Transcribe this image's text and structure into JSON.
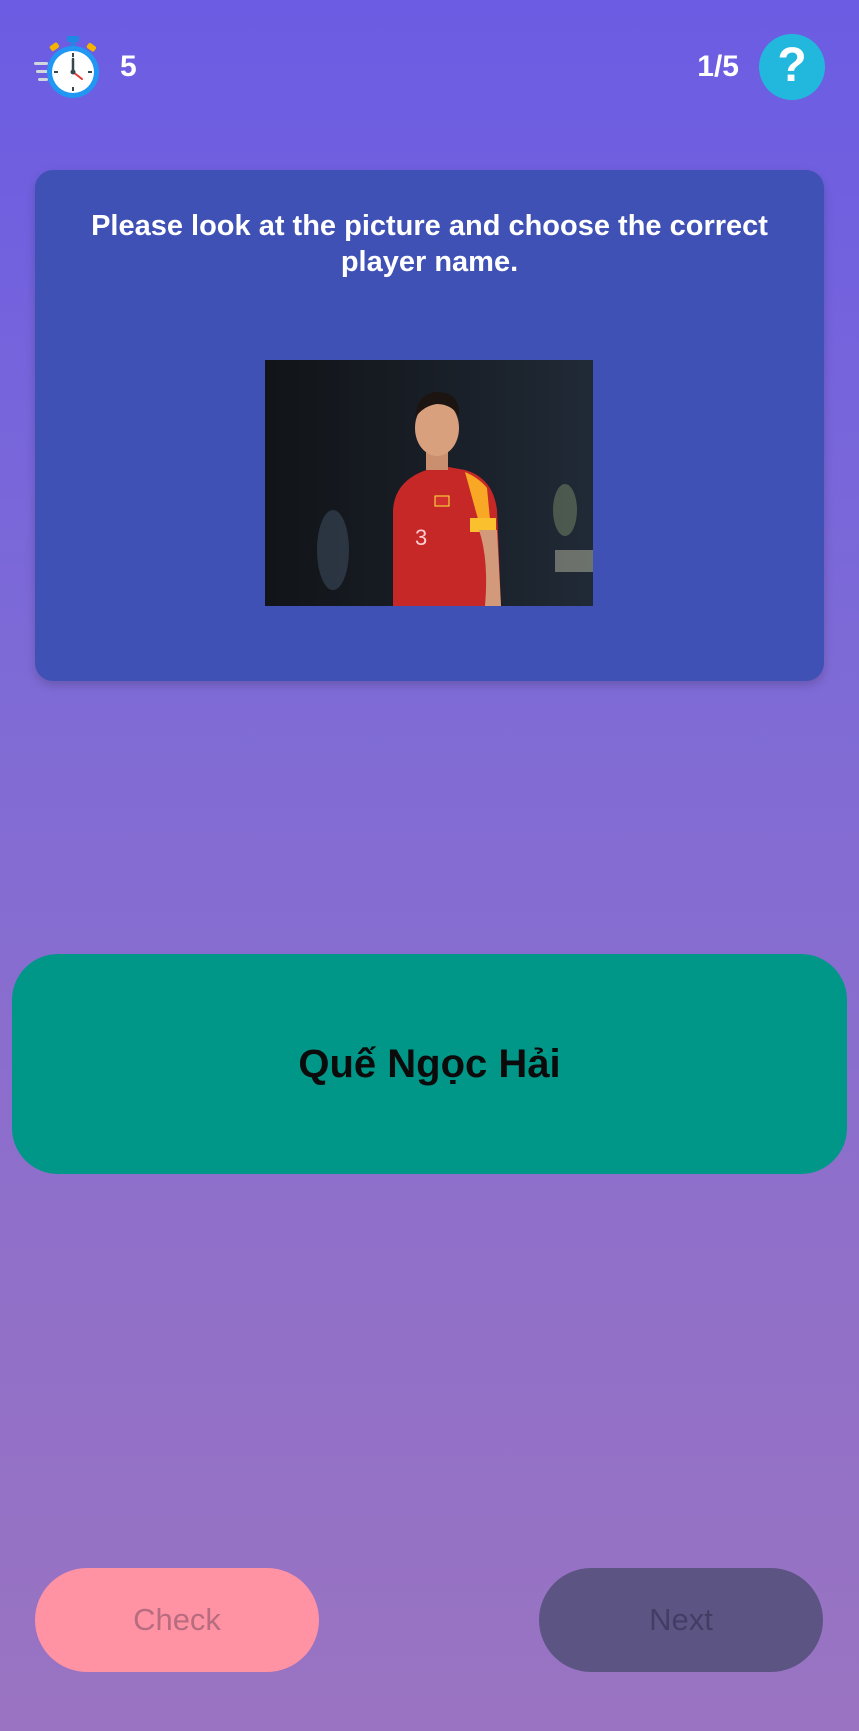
{
  "header": {
    "timer_icon": "stopwatch-icon",
    "timer_value": "5",
    "progress": "1/5",
    "help_label": "?",
    "help_icon": "question-mark-icon"
  },
  "question": {
    "prompt": "Please look at the picture and choose the correct player name.",
    "image": "player-photo-icon"
  },
  "answer": {
    "label": "Quế Ngọc Hải"
  },
  "actions": {
    "check_label": "Check",
    "next_label": "Next"
  },
  "colors": {
    "card": "#3f51b5",
    "answer": "#009688",
    "check_button": "#ff93a3",
    "next_button": "#5c5584",
    "help_button": "#22b7dc"
  }
}
